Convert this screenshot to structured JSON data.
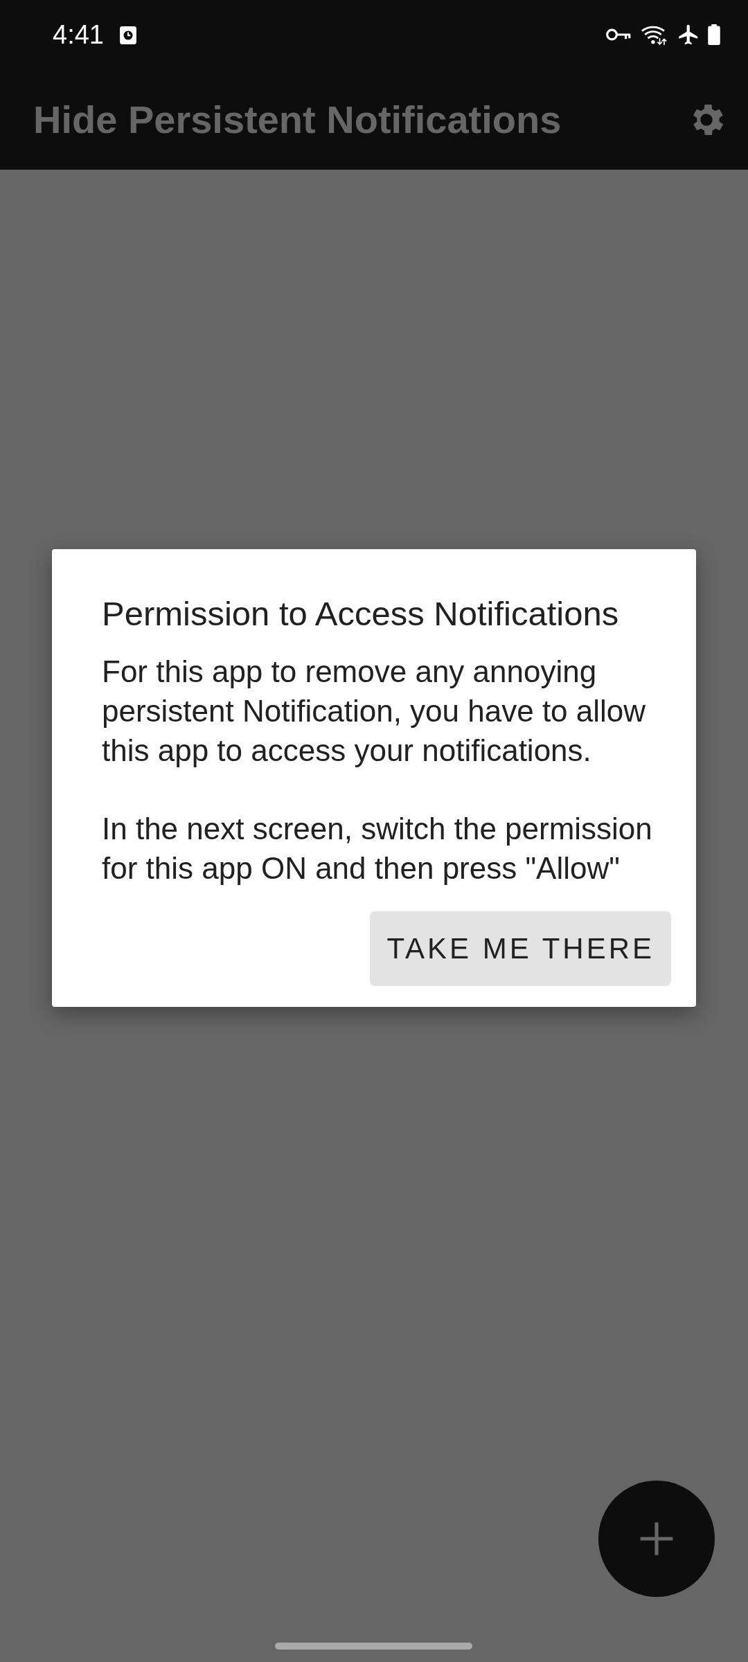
{
  "status_bar": {
    "time": "4:41"
  },
  "toolbar": {
    "title": "Hide Persistent Notifications"
  },
  "dialog": {
    "title": "Permission to Access Notifications",
    "paragraphs": [
      "For this app to remove any annoying persistent Notification, you have to allow this app to access your notifications.",
      "In the next screen, switch the permission for this app ON and then press \"Allow\""
    ],
    "button": "TAKE ME THERE"
  }
}
